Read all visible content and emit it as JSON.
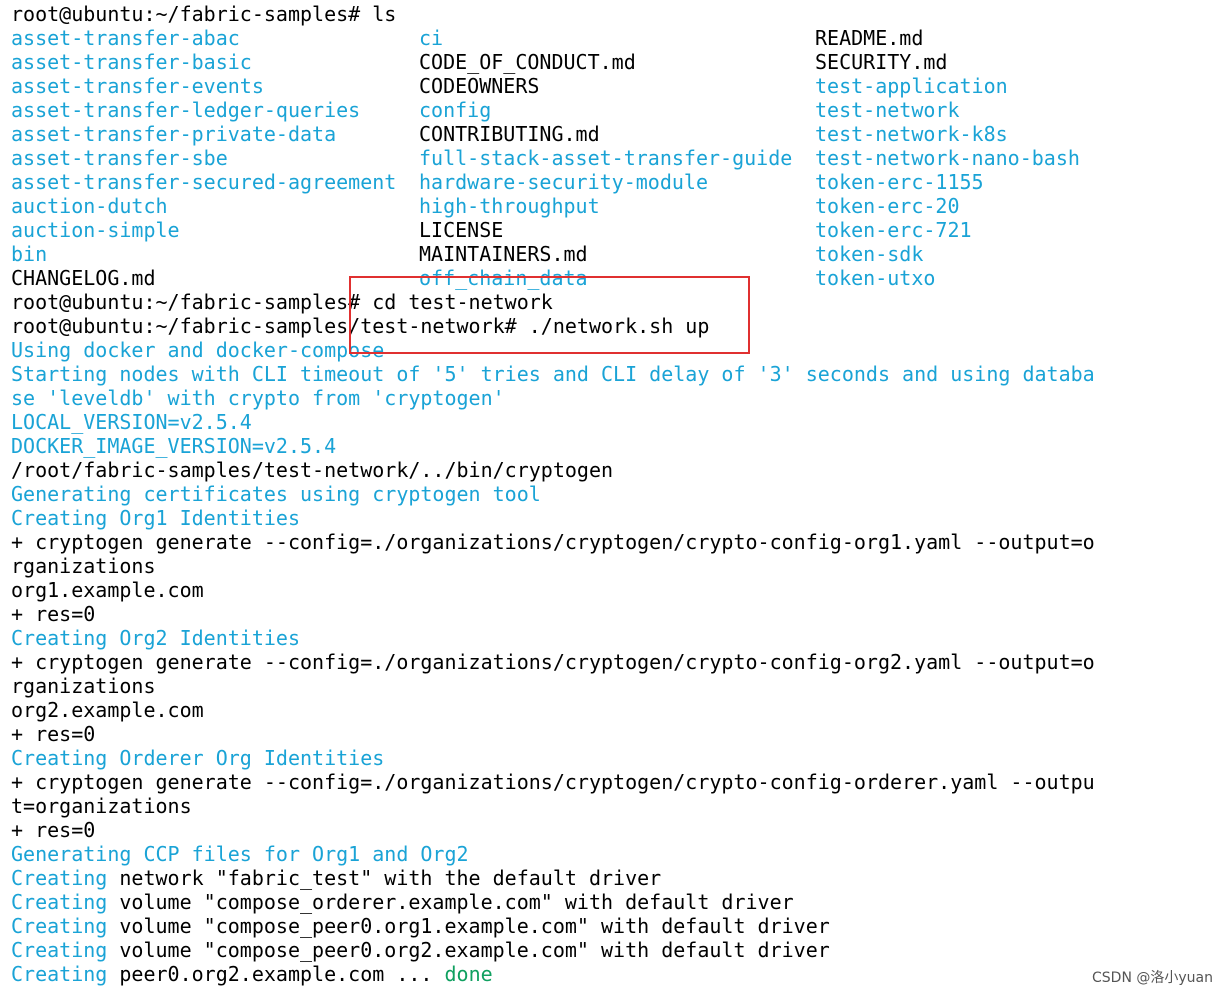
{
  "prompt_line_1": "root@ubuntu:~/fabric-samples# ls",
  "ls_rows": [
    [
      "asset-transfer-abac",
      "ci",
      "README.md"
    ],
    [
      "asset-transfer-basic",
      "CODE_OF_CONDUCT.md",
      "SECURITY.md"
    ],
    [
      "asset-transfer-events",
      "CODEOWNERS",
      "test-application"
    ],
    [
      "asset-transfer-ledger-queries",
      "config",
      "test-network"
    ],
    [
      "asset-transfer-private-data",
      "CONTRIBUTING.md",
      "test-network-k8s"
    ],
    [
      "asset-transfer-sbe",
      "full-stack-asset-transfer-guide",
      "test-network-nano-bash"
    ],
    [
      "asset-transfer-secured-agreement",
      "hardware-security-module",
      "token-erc-1155"
    ],
    [
      "auction-dutch",
      "high-throughput",
      "token-erc-20"
    ],
    [
      "auction-simple",
      "LICENSE",
      "token-erc-721"
    ],
    [
      "bin",
      "MAINTAINERS.md",
      "token-sdk"
    ],
    [
      "CHANGELOG.md",
      "off_chain_data",
      "token-utxo"
    ]
  ],
  "ls_row_colors": [
    [
      "blue",
      "blue",
      "black"
    ],
    [
      "blue",
      "black",
      "black"
    ],
    [
      "blue",
      "black",
      "blue"
    ],
    [
      "blue",
      "blue",
      "blue"
    ],
    [
      "blue",
      "black",
      "blue"
    ],
    [
      "blue",
      "blue",
      "blue"
    ],
    [
      "blue",
      "blue",
      "blue"
    ],
    [
      "blue",
      "blue",
      "blue"
    ],
    [
      "blue",
      "black",
      "blue"
    ],
    [
      "blue",
      "black",
      "blue"
    ],
    [
      "black",
      "blue",
      "blue"
    ]
  ],
  "output_lines": [
    {
      "text": "root@ubuntu:~/fabric-samples# cd test-network",
      "color": "black"
    },
    {
      "text": "root@ubuntu:~/fabric-samples/test-network# ./network.sh up",
      "color": "black"
    },
    {
      "text": "Using docker and docker-compose",
      "color": "blue"
    },
    {
      "text": "Starting nodes with CLI timeout of '5' tries and CLI delay of '3' seconds and using databa",
      "color": "blue"
    },
    {
      "text": "se 'leveldb' with crypto from 'cryptogen'",
      "color": "blue"
    },
    {
      "text": "LOCAL_VERSION=v2.5.4",
      "color": "blue"
    },
    {
      "text": "DOCKER_IMAGE_VERSION=v2.5.4",
      "color": "blue"
    },
    {
      "text": "/root/fabric-samples/test-network/../bin/cryptogen",
      "color": "black"
    },
    {
      "text": "Generating certificates using cryptogen tool",
      "color": "blue"
    },
    {
      "text": "Creating Org1 Identities",
      "color": "blue"
    },
    {
      "text": "+ cryptogen generate --config=./organizations/cryptogen/crypto-config-org1.yaml --output=o",
      "color": "black"
    },
    {
      "text": "rganizations",
      "color": "black"
    },
    {
      "text": "org1.example.com",
      "color": "black"
    },
    {
      "text": "+ res=0",
      "color": "black"
    },
    {
      "text": "Creating Org2 Identities",
      "color": "blue"
    },
    {
      "text": "+ cryptogen generate --config=./organizations/cryptogen/crypto-config-org2.yaml --output=o",
      "color": "black"
    },
    {
      "text": "rganizations",
      "color": "black"
    },
    {
      "text": "org2.example.com",
      "color": "black"
    },
    {
      "text": "+ res=0",
      "color": "black"
    },
    {
      "text": "Creating Orderer Org Identities",
      "color": "blue"
    },
    {
      "text": "+ cryptogen generate --config=./organizations/cryptogen/crypto-config-orderer.yaml --outpu",
      "color": "black"
    },
    {
      "text": "t=organizations",
      "color": "black"
    },
    {
      "text": "+ res=0",
      "color": "black"
    },
    {
      "text": "Generating CCP files for Org1 and Org2",
      "color": "blue"
    }
  ],
  "creating_lines": [
    {
      "prefix": "Creating",
      "rest": " network \"fabric_test\" with the default driver"
    },
    {
      "prefix": "Creating",
      "rest": " volume \"compose_orderer.example.com\" with default driver"
    },
    {
      "prefix": "Creating",
      "rest": " volume \"compose_peer0.org1.example.com\" with default driver"
    },
    {
      "prefix": "Creating",
      "rest": " volume \"compose_peer0.org2.example.com\" with default driver"
    }
  ],
  "last_line": {
    "prefix": "Creating",
    "middle": " peer0.org2.example.com ... ",
    "status": "done"
  },
  "watermark": "CSDN @洛小yuan",
  "colors": {
    "blue": "#1aa3d6",
    "green": "#10a060",
    "black": "#000000",
    "highlight": "#e03030",
    "background": "#ffffff"
  }
}
